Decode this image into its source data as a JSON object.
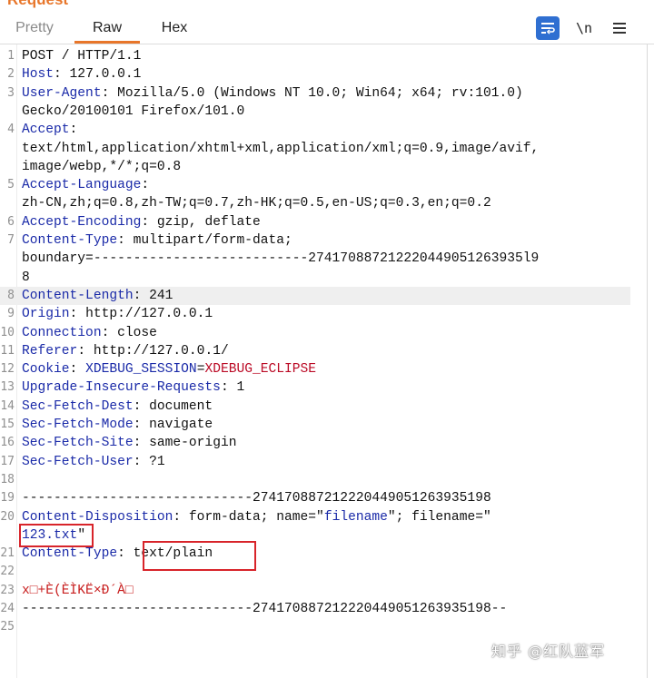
{
  "panel_title": "Request",
  "tabs": [
    {
      "label": "Pretty",
      "active": false
    },
    {
      "label": "Raw",
      "active": true
    },
    {
      "label": "Hex",
      "active": false
    }
  ],
  "toolbar": {
    "wrap_icon": "wrap-lines-icon",
    "newline_label": "\\n",
    "menu_icon": "hamburger-menu-icon"
  },
  "colors": {
    "accent": "#e8762a",
    "header_key": "#1a2aa8",
    "cookie_value": "#bb0a25",
    "highlight_box": "#d8242a",
    "wrap_button": "#2f6fd1"
  },
  "lines": [
    {
      "n": "1",
      "text": "POST / HTTP/1.1"
    },
    {
      "n": "2",
      "key": "Host",
      "value": " 127.0.0.1"
    },
    {
      "n": "3",
      "key": "User-Agent",
      "value": " Mozilla/5.0 (Windows NT 10.0; Win64; x64; rv:101.0)"
    },
    {
      "n": "",
      "text": "Gecko/20100101 Firefox/101.0"
    },
    {
      "n": "4",
      "key": "Accept",
      "value": ""
    },
    {
      "n": "",
      "text": "text/html,application/xhtml+xml,application/xml;q=0.9,image/avif,"
    },
    {
      "n": "",
      "text": "image/webp,*/*;q=0.8"
    },
    {
      "n": "5",
      "key": "Accept-Language",
      "value": ""
    },
    {
      "n": "",
      "text": "zh-CN,zh;q=0.8,zh-TW;q=0.7,zh-HK;q=0.5,en-US;q=0.3,en;q=0.2"
    },
    {
      "n": "6",
      "key": "Accept-Encoding",
      "value": " gzip, deflate"
    },
    {
      "n": "7",
      "key": "Content-Type",
      "value": " multipart/form-data;"
    },
    {
      "n": "",
      "text": "boundary=---------------------------274170887212220449051263935l9"
    },
    {
      "n": "",
      "text": "8"
    },
    {
      "n": "8",
      "key": "Content-Length",
      "value": " 241",
      "highlight": true
    },
    {
      "n": "9",
      "key": "Origin",
      "value": " http://127.0.0.1"
    },
    {
      "n": "10",
      "key": "Connection",
      "value": " close"
    },
    {
      "n": "11",
      "key": "Referer",
      "value": " http://127.0.0.1/"
    },
    {
      "n": "12",
      "key": "Cookie",
      "value": " ",
      "cookie_name": "XDEBUG_SESSION",
      "cookie_eq": "=",
      "cookie_value": "XDEBUG_ECLIPSE"
    },
    {
      "n": "13",
      "key": "Upgrade-Insecure-Requests",
      "value": " 1"
    },
    {
      "n": "14",
      "key": "Sec-Fetch-Dest",
      "value": " document"
    },
    {
      "n": "15",
      "key": "Sec-Fetch-Mode",
      "value": " navigate"
    },
    {
      "n": "16",
      "key": "Sec-Fetch-Site",
      "value": " same-origin"
    },
    {
      "n": "17",
      "key": "Sec-Fetch-User",
      "value": " ?1"
    },
    {
      "n": "18",
      "text": ""
    },
    {
      "n": "19",
      "text": "-----------------------------274170887212220449051263935198"
    },
    {
      "n": "20",
      "key": "Content-Disposition",
      "value": " form-data; name=\"",
      "kw": "filename",
      "value2": "\"; filename=\""
    },
    {
      "n": "",
      "kw": "123.txt",
      "value2": "\""
    },
    {
      "n": "21",
      "key": "Content-Type",
      "value": " text/plain"
    },
    {
      "n": "22",
      "text": ""
    },
    {
      "n": "23",
      "text": "x□+È(ÈÌKË×Ð´À□",
      "garbled": true
    },
    {
      "n": "24",
      "text": "-----------------------------274170887212220449051263935198--"
    },
    {
      "n": "25",
      "text": ""
    }
  ],
  "watermark": "知乎 @红队蓝军"
}
